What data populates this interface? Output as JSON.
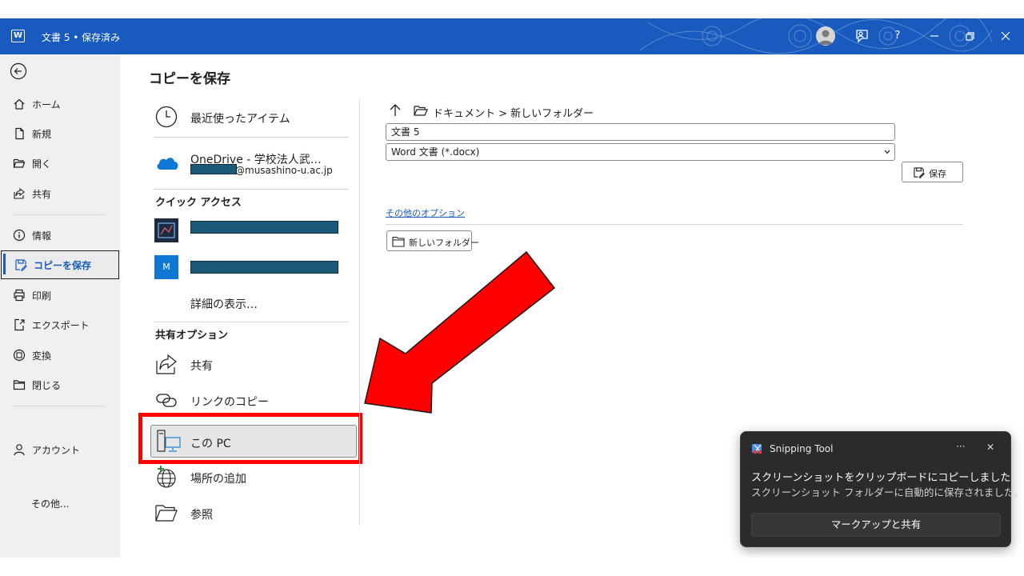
{
  "titlebar": {
    "doc_title": "文書 5 • 保存済み",
    "help_label": "?",
    "logo_icon": "word-logo-icon"
  },
  "nav": {
    "items": [
      {
        "label": "ホーム",
        "icon": "home-icon"
      },
      {
        "label": "新規",
        "icon": "new-document-icon"
      },
      {
        "label": "開く",
        "icon": "open-folder-icon"
      },
      {
        "label": "共有",
        "icon": "share-icon"
      },
      {
        "label": "情報",
        "icon": "info-icon"
      },
      {
        "label": "コピーを保存",
        "icon": "save-copy-icon"
      },
      {
        "label": "印刷",
        "icon": "print-icon"
      },
      {
        "label": "エクスポート",
        "icon": "export-icon"
      },
      {
        "label": "変換",
        "icon": "convert-icon"
      },
      {
        "label": "閉じる",
        "icon": "close-folder-icon"
      }
    ],
    "account": "アカウント",
    "more": "その他..."
  },
  "middle": {
    "title": "コピーを保存",
    "recent": "最近使ったアイテム",
    "onedrive_title": "OneDrive - 学校法人武…",
    "onedrive_email_suffix": "@musashino-u.ac.jp",
    "quick_access": "クイック アクセス",
    "quick_item2_badge": "M",
    "show_more": "詳細の表示…",
    "share_options": "共有オプション",
    "share": "共有",
    "copy_link": "リンクのコピー",
    "this_pc": "この PC",
    "add_place": "場所の追加",
    "browse": "参照"
  },
  "right": {
    "breadcrumb": "ドキュメント > 新しいフォルダー",
    "filename": "文書 5",
    "filetype": "Word 文書 (*.docx)",
    "save_btn": "保存",
    "other_options": "その他のオプション",
    "new_folder_btn": "新しいフォルダー"
  },
  "toast": {
    "app_name": "Snipping Tool",
    "more": "···",
    "close": "✕",
    "title": "スクリーンショットをクリップボードにコピーしました",
    "message": "スクリーンショット フォルダーに自動的に保存されました。",
    "action": "マークアップと共有"
  },
  "colors": {
    "brand": "#185abd",
    "annotation_red": "#ff0000",
    "redaction": "#1d5a7a"
  }
}
